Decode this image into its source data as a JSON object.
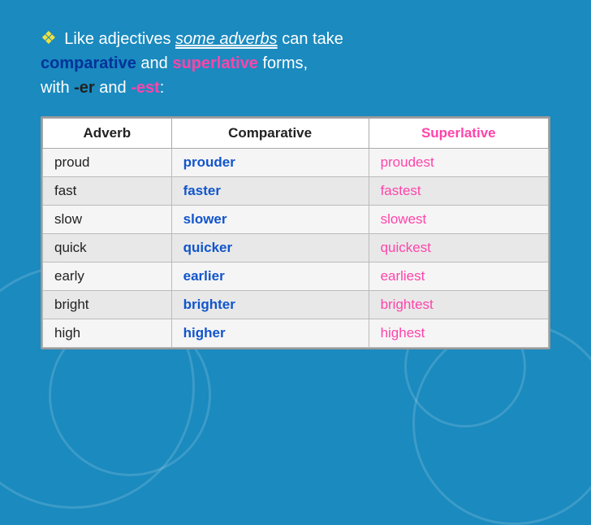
{
  "intro": {
    "diamond": "❖",
    "line1_before": " Like adjectives ",
    "line1_italic": "some adverbs",
    "line1_after": " can take",
    "line2_bold_blue": "comparative",
    "line2_mid": " and ",
    "line2_bold_pink": "superlative",
    "line2_end": " forms,",
    "line3_start": "with ",
    "er_part": "-er",
    "line3_mid": " and ",
    "est_part": "-est",
    "line3_end": ":"
  },
  "table": {
    "headers": [
      "Adverb",
      "Comparative",
      "Superlative"
    ],
    "rows": [
      {
        "adverb": "proud",
        "comparative": "prouder",
        "superlative": "proudest"
      },
      {
        "adverb": "fast",
        "comparative": "faster",
        "superlative": "fastest"
      },
      {
        "adverb": "slow",
        "comparative": "slower",
        "superlative": "slowest"
      },
      {
        "adverb": "quick",
        "comparative": "quicker",
        "superlative": "quickest"
      },
      {
        "adverb": "early",
        "comparative": "earlier",
        "superlative": "earliest"
      },
      {
        "adverb": "bright",
        "comparative": "brighter",
        "superlative": "brightest"
      },
      {
        "adverb": "high",
        "comparative": "higher",
        "superlative": "highest"
      }
    ]
  }
}
